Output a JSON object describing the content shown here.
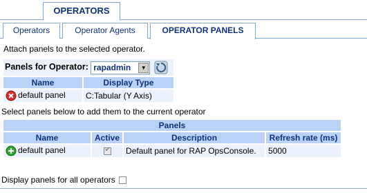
{
  "tabs": {
    "top": "OPERATORS",
    "sub": [
      "Operators",
      "Operator Agents",
      "OPERATOR PANELS"
    ]
  },
  "intro": "Attach panels to the selected operator.",
  "operator_select": {
    "label": "Panels for Operator:",
    "value": "rapadmin"
  },
  "attached_table": {
    "headers": [
      "Name",
      "Display Type"
    ],
    "rows": [
      {
        "name": "default panel",
        "display_type": "C:Tabular (Y Axis)",
        "icon": "remove-icon"
      }
    ]
  },
  "select_text": "Select panels below to add them to the current operator",
  "panels_table": {
    "title": "Panels",
    "headers": [
      "Name",
      "Active",
      "Description",
      "Refresh rate (ms)"
    ],
    "rows": [
      {
        "name": "default panel",
        "active": true,
        "description": "Default panel for RAP OpsConsole.",
        "refresh": "5000",
        "icon": "add-icon"
      }
    ]
  },
  "display_all": {
    "label": "Display panels for all operators",
    "checked": false
  },
  "colors": {
    "tab_text": "#10317c",
    "header_bg": "#b9d2f5",
    "row_bg": "#ecf2fb",
    "border": "#7ea6d6"
  }
}
